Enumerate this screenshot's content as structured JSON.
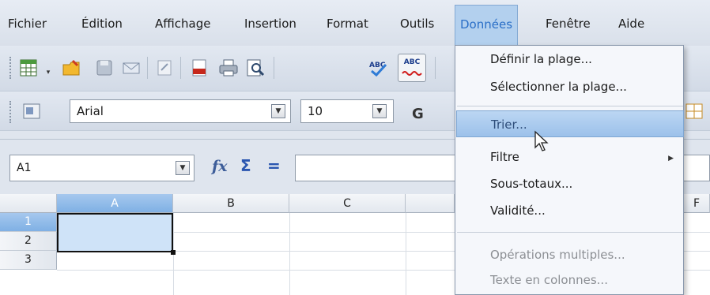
{
  "menubar": {
    "items": [
      {
        "label": "Fichier"
      },
      {
        "label": "Édition"
      },
      {
        "label": "Affichage"
      },
      {
        "label": "Insertion"
      },
      {
        "label": "Format"
      },
      {
        "label": "Outils"
      },
      {
        "label": "Données"
      },
      {
        "label": "Fenêtre"
      },
      {
        "label": "Aide"
      }
    ]
  },
  "toolbar": {
    "font_name": "Arial",
    "font_size": "10",
    "bold_label": "G",
    "spell_button": "ABC"
  },
  "formula_bar": {
    "cell_ref": "A1",
    "fx_label": "fx",
    "sum_label": "Σ",
    "equals_label": "="
  },
  "sheet": {
    "columns": [
      "A",
      "B",
      "C",
      "F"
    ],
    "rows": [
      "1",
      "2",
      "3"
    ]
  },
  "data_menu": {
    "items": [
      {
        "label": "Définir la plage...",
        "enabled": true
      },
      {
        "label": "Sélectionner la plage...",
        "enabled": true
      },
      {
        "label": "Trier...",
        "enabled": true,
        "highlighted": true
      },
      {
        "label": "Filtre",
        "enabled": true,
        "submenu": true
      },
      {
        "label": "Sous-totaux...",
        "enabled": true
      },
      {
        "label": "Validité...",
        "enabled": true
      },
      {
        "label": "Opérations multiples...",
        "enabled": false
      },
      {
        "label": "Texte en colonnes...",
        "enabled": false
      }
    ]
  },
  "colors": {
    "menu_active_bg": "#b3d0ee",
    "highlight_bg": "#9cc1ea",
    "selection_header": "#7fb0e4",
    "disabled_text": "#8c8f94"
  }
}
